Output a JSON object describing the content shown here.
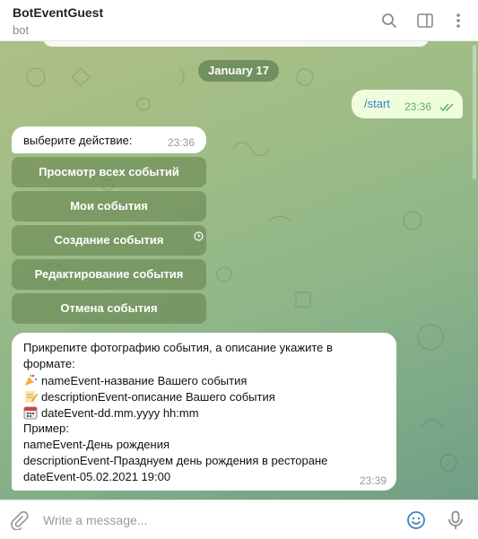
{
  "header": {
    "title": "BotEventGuest",
    "subtitle": "bot",
    "icons": [
      "search-icon",
      "sidebar-toggle-icon",
      "more-vertical-icon"
    ]
  },
  "chat": {
    "date_label": "January 17",
    "outgoing": {
      "text": "/start",
      "time": "23:36",
      "status_icon": "double-check-icon"
    },
    "incoming_prompt": {
      "text": "выберите действие:",
      "time": "23:36"
    },
    "keyboard": [
      {
        "label": "Просмотр всех событий"
      },
      {
        "label": "Мои события"
      },
      {
        "label": "Создание события",
        "icon": "clock-icon"
      },
      {
        "label": "Редактирование события"
      },
      {
        "label": "Отмена события"
      }
    ],
    "instruction": {
      "line1": "Прикрепите фотографию события, а описание укажите в",
      "line2": "формате:",
      "field1": "nameEvent-название Вашего события",
      "field2": "descriptionEvent-описание Вашего события",
      "field3": "dateEvent-dd.mm.yyyy hh:mm",
      "example_label": "Пример:",
      "example1": "nameEvent-День рождения",
      "example2": "descriptionEvent-Празднуем день рождения в ресторане",
      "example3": "dateEvent-05.02.2021 19:00",
      "emoji_icons": [
        "party-popper-icon",
        "memo-icon",
        "calendar-icon"
      ],
      "time": "23:39"
    }
  },
  "composer": {
    "placeholder": "Write a message...",
    "icons": [
      "paperclip-icon",
      "smile-icon",
      "microphone-icon"
    ]
  },
  "colors": {
    "accent": "#3a84c4",
    "outgoing_bubble": "#effdde",
    "read_ticks": "#5fae5a",
    "keyboard_button": "#6a8a55",
    "date_pill": "#628052"
  }
}
